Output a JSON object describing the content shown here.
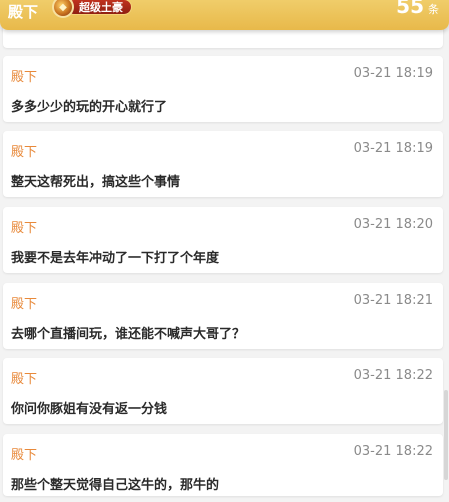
{
  "header": {
    "user_name": "殿下",
    "badge_label": "超级土豪",
    "count_value": "55",
    "count_unit": "条"
  },
  "messages": [
    {
      "name": "殿下",
      "time": "03-21 18:19",
      "text": "多多少少的玩的开心就行了"
    },
    {
      "name": "殿下",
      "time": "03-21 18:19",
      "text": "整天这帮死出，搞这些个事情"
    },
    {
      "name": "殿下",
      "time": "03-21 18:20",
      "text": "我要不是去年冲动了一下打了个年度"
    },
    {
      "name": "殿下",
      "time": "03-21 18:21",
      "text": "去哪个直播间玩，谁还能不喊声大哥了？"
    },
    {
      "name": "殿下",
      "time": "03-21 18:22",
      "text": "你问你豚姐有没有返一分钱"
    },
    {
      "name": "殿下",
      "time": "03-21 18:22",
      "text": "那些个整天觉得自己这牛的，那牛的"
    }
  ],
  "colors": {
    "header_gold": "#e8b94a",
    "name_orange": "#e8893a",
    "badge_red": "#a8261a"
  }
}
